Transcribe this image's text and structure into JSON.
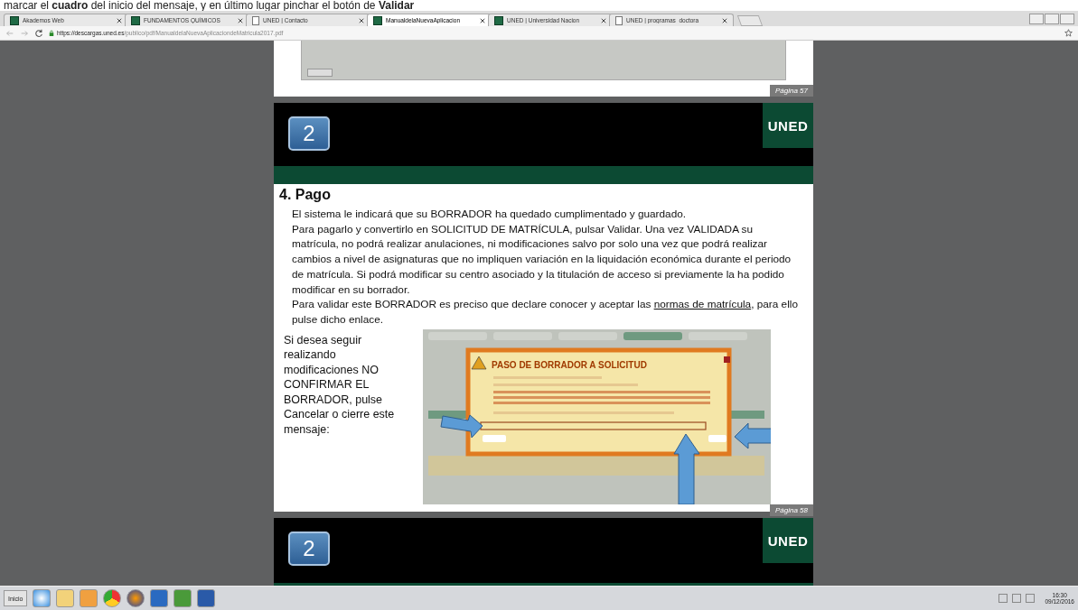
{
  "caption": "marcar el **cuadro** del inicio del mensaje, y en último lugar pinchar el botón de **Validar**",
  "tabs": [
    {
      "title": "Akademos Web",
      "kind": "site",
      "selected": false
    },
    {
      "title": "FUNDAMENTOS QUÍMICOS",
      "kind": "site",
      "selected": false
    },
    {
      "title": "UNED | Contacto",
      "kind": "page",
      "selected": false
    },
    {
      "title": "ManualdelaNuevaAplicacion",
      "kind": "site",
      "selected": true
    },
    {
      "title": "UNED | Universidad Nacion",
      "kind": "site",
      "selected": false
    },
    {
      "title": "UNED | programas_doctora",
      "kind": "page",
      "selected": false
    }
  ],
  "address": {
    "host": "https://descargas.uned.es",
    "path": "/publico/pdf/ManualdelaNuevaAplicaciondeMatricula2017.pdf"
  },
  "previous_page": {
    "page_label": "Página 57"
  },
  "slide": {
    "number": "2",
    "logo": "UNED",
    "section_title": "4. Pago",
    "paragraphs": [
      "El sistema le indicará que su BORRADOR ha quedado cumplimentado y guardado.",
      "Para pagarlo y convertirlo en SOLICITUD DE MATRÍCULA, pulsar Validar. Una vez VALIDADA su matrícula, no podrá realizar anulaciones, ni modificaciones salvo por solo una vez que podrá realizar cambios a nivel de asignaturas que no impliquen variación en la liquidación económica durante el periodo de matrícula. Si podrá modificar su centro asociado y la titulación de acceso si previamente la ha podido modificar en su borrador."
    ],
    "link_sentence": {
      "before": "Para validar este BORRADOR es preciso que declare conocer y aceptar las ",
      "link": "normas de matrícula",
      "after": ", para ello pulse dicho enlace."
    },
    "side_note": "Si desea seguir realizando modificaciones NO CONFIRMAR EL BORRADOR, pulse Cancelar o cierre este mensaje:",
    "dialog_title": "PASO DE BORRADOR A SOLICITUD",
    "page_label": "Página 58"
  },
  "next_slide": {
    "number": "2",
    "logo": "UNED"
  },
  "taskbar": {
    "start": "Inicio",
    "time": "16:30",
    "date": "09/12/2016"
  }
}
